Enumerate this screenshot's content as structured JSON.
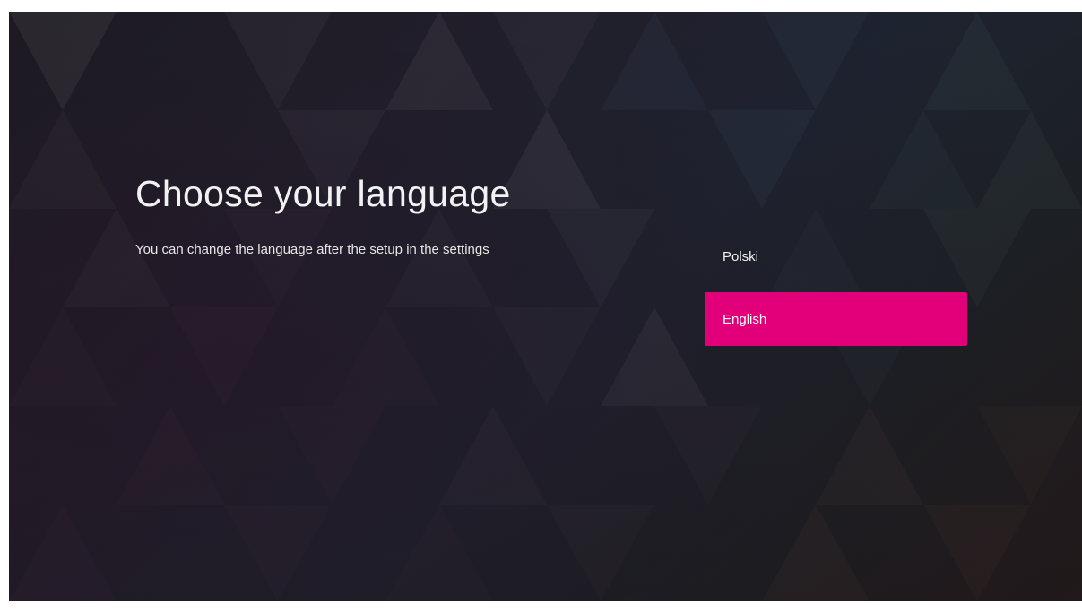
{
  "setup": {
    "title": "Choose your language",
    "subtitle": "You can change the language after the setup in the settings"
  },
  "languages": {
    "items": [
      {
        "label": "Polski",
        "selected": false
      },
      {
        "label": "English",
        "selected": true
      }
    ]
  },
  "colors": {
    "accent": "#e2007a",
    "background": "#1f1d26",
    "text": "#f2f2f2"
  }
}
